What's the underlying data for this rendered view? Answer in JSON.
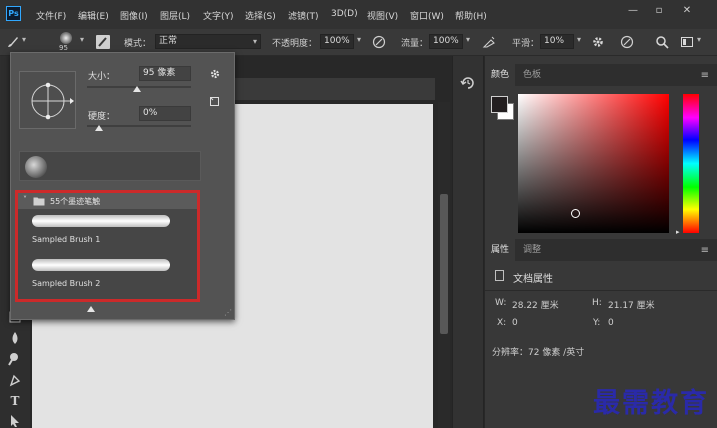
{
  "app": {
    "logo": "Ps"
  },
  "menu": {
    "items": [
      "文件(F)",
      "编辑(E)",
      "图像(I)",
      "图层(L)",
      "文字(Y)",
      "选择(S)",
      "滤镜(T)",
      "3D(D)",
      "视图(V)",
      "窗口(W)",
      "帮助(H)"
    ]
  },
  "window_controls": {
    "minimize": "—",
    "restore": "▫",
    "close": "✕"
  },
  "options_bar": {
    "brush_size": "95",
    "mode_label": "模式：",
    "mode_value": "正常",
    "opacity_label": "不透明度：",
    "opacity_value": "100%",
    "flow_label": "流量：",
    "flow_value": "100%",
    "smoothing_label": "平滑：",
    "smoothing_value": "10%"
  },
  "brush_picker": {
    "size_label": "大小：",
    "size_value": "95 像素",
    "hardness_label": "硬度：",
    "hardness_value": "0%",
    "size_level": 0.48,
    "hardness_level": 0.0,
    "group_name": "55个墨迹笔触",
    "brushes": [
      "Sampled Brush 1",
      "Sampled Brush 2"
    ]
  },
  "color_panel": {
    "tabs": [
      "颜色",
      "色板"
    ],
    "foreground": "#231f20",
    "background": "#ffffff",
    "hue": "#ff0000",
    "saturation": 0.09,
    "brightness": 0.12
  },
  "properties_panel": {
    "tabs": [
      "属性",
      "调整"
    ],
    "title": "文档属性",
    "w_label": "W:",
    "w_value": "28.22 厘米",
    "h_label": "H:",
    "h_value": "21.17 厘米",
    "x_label": "X:",
    "x_value": "0",
    "y_label": "Y:",
    "y_value": "0",
    "resolution": "分辨率：72 像素 /英寸"
  },
  "watermark": "最需教育"
}
